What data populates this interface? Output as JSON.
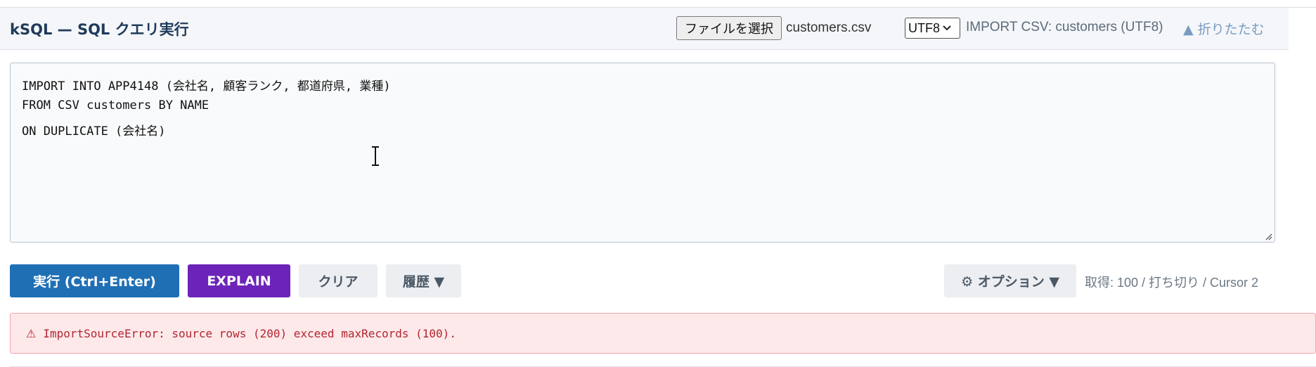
{
  "header": {
    "title": "kSQL — SQL クエリ実行",
    "file_button_label": "ファイルを選択",
    "file_name": "customers.csv",
    "encoding_selected": "UTF8",
    "import_status": "IMPORT CSV: customers (UTF8)",
    "collapse_label": "▲ 折りたたむ"
  },
  "editor": {
    "lines": [
      "IMPORT INTO APP4148 (会社名, 顧客ランク, 都道府県, 業種)",
      "FROM CSV customers BY NAME",
      "ON DUPLICATE (会社名)"
    ]
  },
  "toolbar": {
    "run_label": "実行 (Ctrl+Enter)",
    "explain_label": "EXPLAIN",
    "clear_label": "クリア",
    "history_label": "履歴 ▼",
    "options_label": "⚙ オプション ▼",
    "fetch_status": "取得: 100 / 打ち切り / Cursor 2"
  },
  "error": {
    "icon": "warning-icon",
    "message": "ImportSourceError: source rows (200) exceed maxRecords (100)."
  },
  "colors": {
    "run": "#1f6fb5",
    "explain": "#6c24b8",
    "error_bg": "#fde8ea",
    "error_text": "#b3262f"
  }
}
